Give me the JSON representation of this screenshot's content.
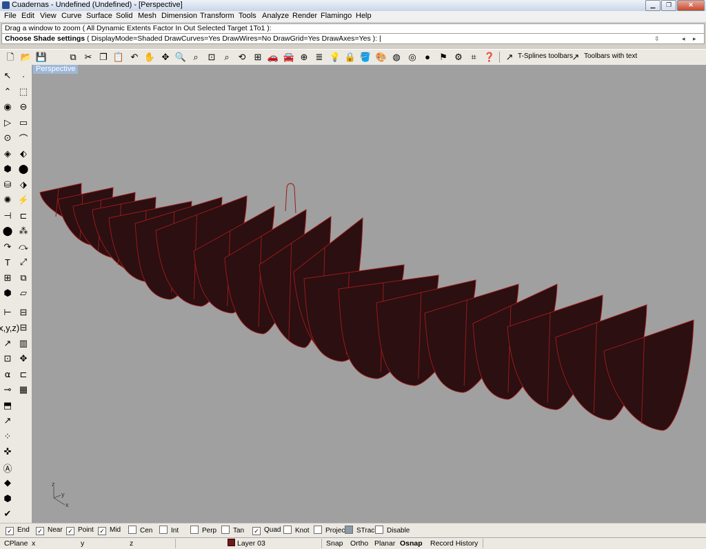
{
  "window": {
    "title": "Cuadernas - Undefined (Undefined) - [Perspective]",
    "minimize_icon": "minimize-icon",
    "maximize_icon": "restore-icon",
    "close_icon": "close-icon"
  },
  "menu": [
    "File",
    "Edit",
    "View",
    "Curve",
    "Surface",
    "Solid",
    "Mesh",
    "Dimension",
    "Transform",
    "Tools",
    "Analyze",
    "Render",
    "Flamingo",
    "Help"
  ],
  "command": {
    "history": "Drag a window to zoom ( All  Dynamic  Extents  Factor  In  Out  Selected  Target  1To1 ):",
    "prompt_label": "Choose Shade settings",
    "prompt_options": "( DisplayMode=Shaded  DrawCurves=Yes  DrawWires=No  DrawGrid=Yes  DrawAxes=Yes ):"
  },
  "toolbar": {
    "tsplines_label": "T-Splines toolbars",
    "toolbars_text_label": "Toolbars with text"
  },
  "viewport": {
    "title": "Perspective",
    "axis_x": "x",
    "axis_y": "y",
    "axis_z": "z",
    "background": "#a0a0a0",
    "frame_color": "#2b0f11",
    "edge_color": "#9a1a1a"
  },
  "osnaps": [
    {
      "label": "End",
      "checked": true
    },
    {
      "label": "Near",
      "checked": true
    },
    {
      "label": "Point",
      "checked": true
    },
    {
      "label": "Mid",
      "checked": true
    },
    {
      "label": "Cen",
      "checked": false
    },
    {
      "label": "Int",
      "checked": false
    },
    {
      "label": "Perp",
      "checked": false
    },
    {
      "label": "Tan",
      "checked": false
    },
    {
      "label": "Quad",
      "checked": true
    },
    {
      "label": "Knot",
      "checked": false
    },
    {
      "label": "Project",
      "checked": false
    },
    {
      "label": "STrack",
      "checked": false
    },
    {
      "label": "Disable",
      "checked": false
    }
  ],
  "status": {
    "cplane": "CPlane",
    "x": "x",
    "y": "y",
    "z": "z",
    "layer": "Layer 03",
    "layer_color": "#6b1a1a",
    "snap": "Snap",
    "ortho": "Ortho",
    "planar": "Planar",
    "osnap": "Osnap",
    "record_history": "Record History"
  }
}
